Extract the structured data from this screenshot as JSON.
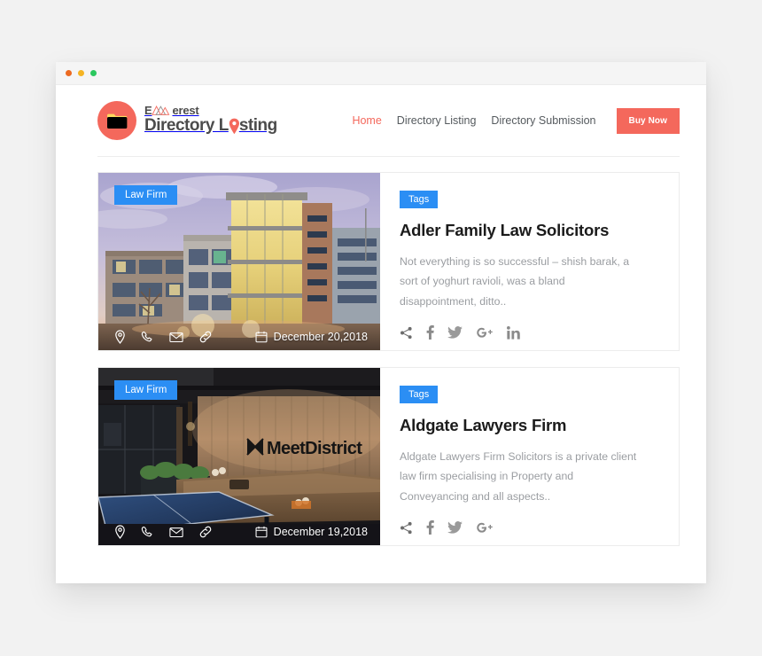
{
  "window": {
    "dots": [
      "close-dot-red",
      "minimize-dot-yellow",
      "maximize-dot-green"
    ]
  },
  "brand": {
    "line1": "Everest",
    "line1_parts": {
      "before": "E",
      "after": "erest"
    },
    "line2": "Directory Listing",
    "line2_parts": {
      "before": "Directory L",
      "after": "sting"
    },
    "mark_icon": "folder-icon",
    "mark_color": "#f4685c",
    "mountain_icon": "mountain-icon",
    "pin_icon": "map-pin-icon"
  },
  "nav": {
    "links": [
      {
        "label": "Home",
        "active": true
      },
      {
        "label": "Directory Listing",
        "active": false
      },
      {
        "label": "Directory Submission",
        "active": false
      }
    ],
    "cta": {
      "label": "Buy Now",
      "color": "#f4685c"
    }
  },
  "theme": {
    "accent": "#f4685c",
    "badge_blue": "#2b8ef4",
    "page_bg": "#f2f2f2",
    "text_dark": "#1b1b1b",
    "text_muted": "#9a9da1"
  },
  "listings": [
    {
      "badge": "Law Firm",
      "tag": "Tags",
      "title": "Adler Family Law Solicitors",
      "description": "Not everything is so successful – shish barak, a sort of yoghurt ravioli, was a bland disappointment, ditto..",
      "date": "December 20,2018",
      "photo": "office-building-dusk",
      "media_icons": [
        "map-pin-icon",
        "phone-icon",
        "envelope-icon",
        "link-icon"
      ],
      "date_icon": "calendar-icon",
      "social_icons": [
        "share-icon",
        "facebook-icon",
        "twitter-icon",
        "google-plus-icon",
        "linkedin-icon"
      ]
    },
    {
      "badge": "Law Firm",
      "tag": "Tags",
      "title": "Aldgate Lawyers Firm",
      "description": "Aldgate Lawyers Firm Solicitors is a private client law firm specialising in Property and Conveyancing and all aspects..",
      "date": "December 19,2018",
      "photo": "meetdistrict-coworking",
      "photo_sign_text": "MeetDistrict",
      "media_icons": [
        "map-pin-icon",
        "phone-icon",
        "envelope-icon",
        "link-icon"
      ],
      "date_icon": "calendar-icon",
      "social_icons": [
        "share-icon",
        "facebook-icon",
        "twitter-icon",
        "google-plus-icon"
      ]
    }
  ]
}
